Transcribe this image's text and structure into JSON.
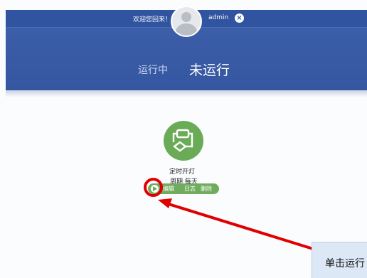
{
  "header": {
    "welcome_text": "欢迎您回来！",
    "username": "admin",
    "close_label": "×"
  },
  "tabs": [
    {
      "label": "运行中",
      "active": false
    },
    {
      "label": "未运行",
      "active": true
    }
  ],
  "task": {
    "name": "定时开灯",
    "period": "周期 每天",
    "actions": {
      "run_icon": "play-icon",
      "edit": "编辑",
      "log": "日志",
      "delete": "删除"
    }
  },
  "tooltip": {
    "text": "单击运行"
  },
  "colors": {
    "header_blue": "#3a5ca6",
    "task_green": "#6aab57",
    "annotation_red": "#e00000"
  }
}
